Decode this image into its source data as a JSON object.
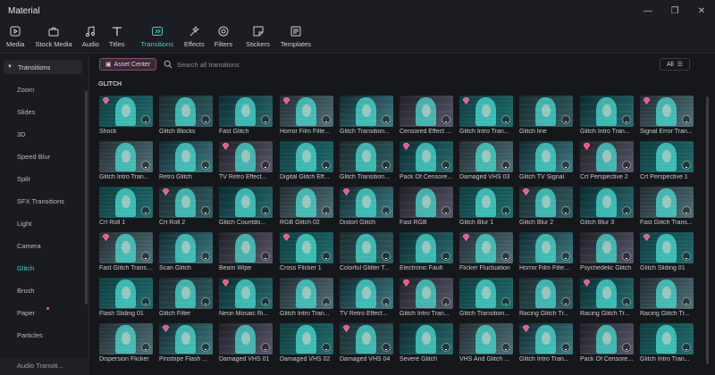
{
  "window": {
    "title": "Material",
    "controls": [
      "—",
      "❐",
      "✕"
    ]
  },
  "toolbar": {
    "items": [
      {
        "label": "Media",
        "icon": "media-icon"
      },
      {
        "label": "Stock Media",
        "icon": "stock-media-icon"
      },
      {
        "label": "Audio",
        "icon": "audio-icon"
      },
      {
        "label": "Titles",
        "icon": "titles-icon"
      },
      {
        "label": "Transitions",
        "icon": "transitions-icon",
        "active": true
      },
      {
        "label": "Effects",
        "icon": "effects-icon"
      },
      {
        "label": "Filters",
        "icon": "filters-icon"
      },
      {
        "label": "Stickers",
        "icon": "stickers-icon"
      },
      {
        "label": "Templates",
        "icon": "templates-icon"
      }
    ]
  },
  "sidebar": {
    "header": "Transitions",
    "items": [
      {
        "label": "Zoom"
      },
      {
        "label": "Slides"
      },
      {
        "label": "3D"
      },
      {
        "label": "Speed Blur"
      },
      {
        "label": "Split"
      },
      {
        "label": "SFX Transitions"
      },
      {
        "label": "Light"
      },
      {
        "label": "Camera"
      },
      {
        "label": "Glitch",
        "active": true
      },
      {
        "label": "Brush"
      },
      {
        "label": "Paper",
        "dot": true
      },
      {
        "label": "Particles"
      }
    ],
    "footer": "Audio Transiti..."
  },
  "main": {
    "asset_center": "Asset Center",
    "search_placeholder": "Search all transitions",
    "filter_label": "All",
    "section": "GLITCH",
    "accent": "#3ed3c3",
    "items": [
      [
        "Shock",
        "Glitch Blocks",
        "Fast Glitch",
        "Horror Film Filte...",
        "Glitch Transition...",
        "Censored Effect ...",
        "Glitch Intro Tran...",
        "Glitch line",
        "Glitch Intro Tran...",
        "Signal Error Tran..."
      ],
      [
        "Glitch Intro Tran...",
        "Retro Glitch",
        "TV Retro Effect...",
        "Digital Glitch Eff...",
        "Glitch Transition...",
        "Pack Of Censore...",
        "Damaged VHS 03",
        "Glitch TV Signal",
        "Crt Perspective 2",
        "Crt Perspective 1"
      ],
      [
        "Crt Roll 1",
        "Crt Roll 2",
        "Glitch Countdo...",
        "RGB Glitch 02",
        "Distort Glitch",
        "Fast RGB",
        "Glitch Blur 1",
        "Glitch Blur 2",
        "Glitch Blur 3",
        "Fast Glitch Trans..."
      ],
      [
        "Fast Glitch Trans...",
        "Scan Glitch",
        "Beam Wipe",
        "Cross Flicker 1",
        "Colorful Glitter T...",
        "Electronic Fault",
        "Flicker Fluctuation",
        "Horror Film Filte...",
        "Psychedelic Glitch",
        "Glitch Sliding 01"
      ],
      [
        "Flash Sliding 01",
        "Glitch Filter",
        "Neon Mosaic Ri...",
        "Glitch Intro Tran...",
        "TV Retro Effect...",
        "Glitch Intro Tran...",
        "Glitch Transition...",
        "Racing Glitch Tr...",
        "Racing Glitch Tr...",
        "Racing Glitch Tr..."
      ],
      [
        "Dispersion Flicker",
        "Pinstripe Flash ...",
        "Damaged VHS 01",
        "Damaged VHS 02",
        "Damaged VHS 04",
        "Severe Glitch",
        "VHS And Glitch ...",
        "Glitch Intro Tran...",
        "Pack Of Censore...",
        "Glitch Intro Tran..."
      ]
    ]
  }
}
